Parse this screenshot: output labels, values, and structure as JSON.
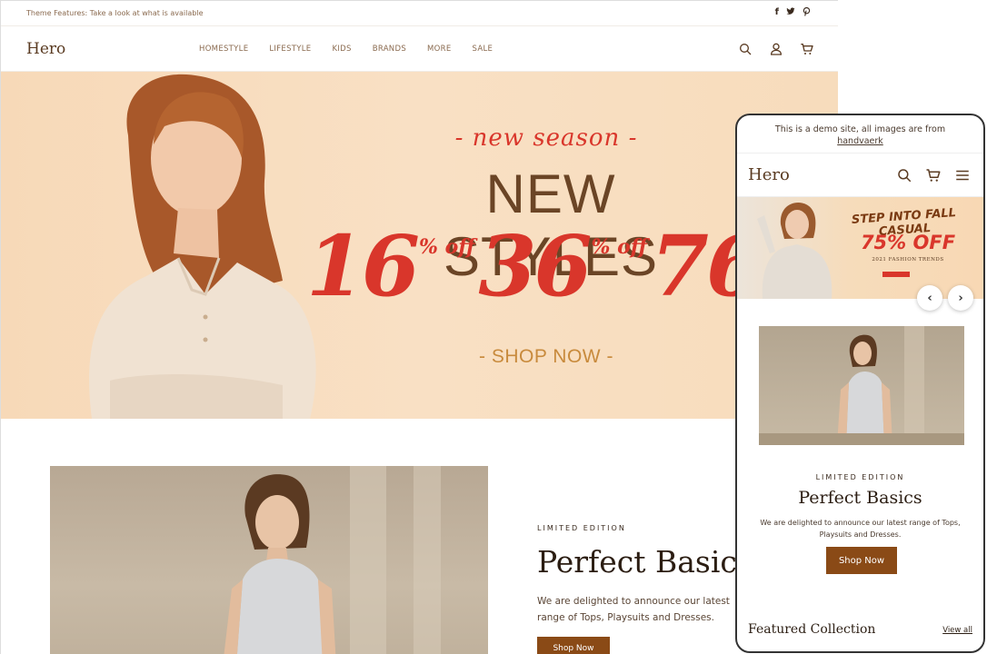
{
  "desktop": {
    "announcement": "Theme Features: Take a look at what is available",
    "social_icons": [
      "facebook-icon",
      "twitter-icon",
      "pinterest-icon"
    ],
    "logo": "Hero",
    "nav": [
      "HOMESTYLE",
      "LIFESTYLE",
      "KIDS",
      "BRANDS",
      "MORE",
      "SALE"
    ],
    "header_icons": [
      "search-icon",
      "account-icon",
      "cart-icon"
    ],
    "hero": {
      "tagline": "- new season -",
      "title": "NEW STYLES",
      "discounts": [
        {
          "value": "16",
          "suffix": "% off"
        },
        {
          "value": "36",
          "suffix": "% off"
        },
        {
          "value": "76",
          "suffix": ""
        }
      ],
      "cta": "- SHOP NOW -"
    },
    "feature": {
      "eyebrow": "LIMITED EDITION",
      "title": "Perfect Basics",
      "text": "We are delighted to announce our latest range of Tops, Playsuits and Dresses.",
      "button": "Shop Now"
    }
  },
  "mobile": {
    "announcement_line1": "This is a demo site, all images are from",
    "announcement_link": "handvaerk",
    "logo": "Hero",
    "header_icons": [
      "search-icon",
      "cart-icon",
      "menu-icon"
    ],
    "banner": {
      "tagline": "STEP INTO FALL CASUAL",
      "offer": "75% OFF",
      "subtitle": "2021 FASHION TRENDS"
    },
    "prev_arrow": "‹",
    "next_arrow": "›",
    "feature": {
      "eyebrow": "LIMITED EDITION",
      "title": "Perfect Basics",
      "text": "We are delighted to announce our latest range of Tops, Playsuits and Dresses.",
      "button": "Shop Now"
    },
    "featured_collection": "Featured Collection",
    "view_all": "View all"
  },
  "colors": {
    "accent_red": "#d9362b",
    "brand_brown": "#8a4a16",
    "hero_bg": "#f8dcbd",
    "text_brown": "#6b4526"
  }
}
